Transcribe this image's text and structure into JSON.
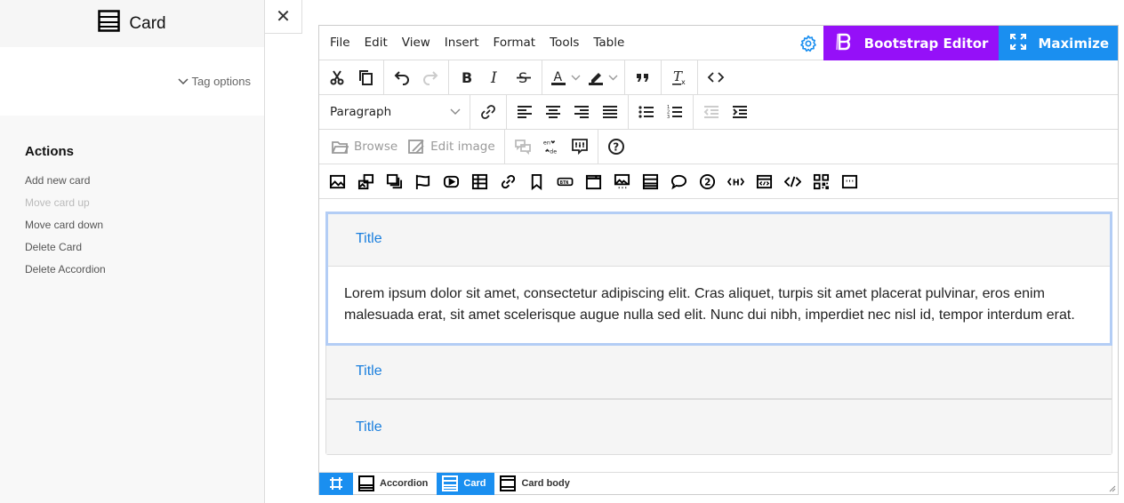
{
  "sidebar": {
    "title": "Card",
    "title_icon": "card-icon",
    "tag_options_label": "Tag options",
    "actions_heading": "Actions",
    "actions": [
      {
        "label": "Add new card",
        "disabled": false
      },
      {
        "label": "Move card up",
        "disabled": true
      },
      {
        "label": "Move card down",
        "disabled": false
      },
      {
        "label": "Delete Card",
        "disabled": false
      },
      {
        "label": "Delete Accordion",
        "disabled": false
      }
    ]
  },
  "close_glyph": "✕",
  "editor": {
    "menu": [
      "File",
      "Edit",
      "View",
      "Insert",
      "Format",
      "Tools",
      "Table"
    ],
    "bootstrap_editor_label": "Bootstrap Editor",
    "maximize_label": "Maximize",
    "colors": {
      "bootstrap": "#9510f8",
      "maximize": "#1a8ff0",
      "title_link": "#1a7fde",
      "selection": "#b3cdf5"
    },
    "block_format": "Paragraph",
    "browse_label": "Browse",
    "edit_image_label": "Edit image",
    "translate_from": "en",
    "translate_to": "de",
    "btn_label": "BTN"
  },
  "accordion": {
    "cards": [
      {
        "title": "Title",
        "body": "Lorem ipsum dolor sit amet, consectetur adipiscing elit. Cras aliquet, turpis sit amet placerat pulvinar, eros enim malesuada erat, sit amet scelerisque augue nulla sed elit. Nunc dui nibh, imperdiet nec nisl id, tempor interdum erat.",
        "selected": true
      },
      {
        "title": "Title"
      },
      {
        "title": "Title"
      }
    ]
  },
  "statusbar": {
    "crumbs": [
      {
        "label": "Accordion",
        "active": false
      },
      {
        "label": "Card",
        "active": true
      },
      {
        "label": "Card body",
        "active": false
      }
    ]
  }
}
